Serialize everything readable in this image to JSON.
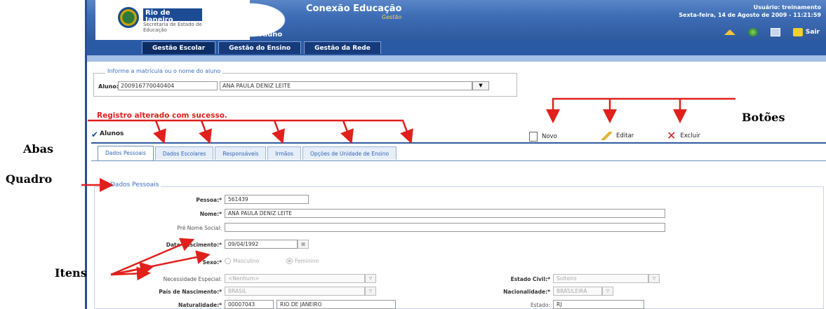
{
  "header": {
    "logo_text": "Rio de Janeiro",
    "logo_sub": "Secretaria de Estado de Educação",
    "app_title": "Conexão Educação",
    "app_subtitle": "Gestão",
    "page_name": "Aluno",
    "user_line": "Usuário: treinamento",
    "date_line": "Sexta-feira, 14 de Agosto de 2009 - 11:21:59",
    "exit_label": "Sair",
    "icons": [
      "home-icon",
      "globe-icon",
      "settings-icon",
      "exit-icon"
    ]
  },
  "nav": {
    "tabs": [
      "Gestão Escolar",
      "Gestão do Ensino",
      "Gestão da Rede"
    ]
  },
  "search": {
    "legend": "Informe a matrícula ou o nome do aluno",
    "label": "Aluno:*",
    "matricula": "200916770040404",
    "name": "ANA PAULA DENIZ LEITE"
  },
  "message": "Registro alterado com sucesso.",
  "section": {
    "title": "Alunos",
    "buttons": {
      "novo": "Novo",
      "editar": "Editar",
      "excluir": "Excluir"
    }
  },
  "tabs": [
    "Dados Pessoais",
    "Dados Escolares",
    "Responsáveis",
    "Irmãos",
    "Opções de Unidade de Ensino"
  ],
  "form": {
    "legend": "Dados Pessoais",
    "pessoa_label": "Pessoa:*",
    "pessoa": "561439",
    "nome_label": "Nome:*",
    "nome": "ANA PAULA DENIZ LEITE",
    "pre_nome_label": "Pré Nome Social:",
    "pre_nome": "",
    "nasc_label": "Data Nascimento:*",
    "nasc": "09/04/1992",
    "sexo_label": "Sexo:*",
    "sexo_options": [
      "Masculino",
      "Feminino"
    ],
    "nec_label": "Necessidade Especial:",
    "nec": "<Nenhum>",
    "estado_civil_label": "Estado Civil:*",
    "estado_civil": "Solteiro",
    "pais_label": "País de Nascimento:*",
    "pais": "BRASIL",
    "nacionalidade_label": "Nacionalidade:*",
    "nacionalidade": "BRASILEIRA",
    "naturalidade_label": "Naturalidade:*",
    "naturalidade_code": "00007043",
    "naturalidade_city": "RIO DE JANEIRO",
    "estado_label": "Estado:",
    "estado": "RJ"
  },
  "annotations": {
    "botoes": "Botões",
    "abas": "Abas",
    "quadro": "Quadro",
    "itens": "Itens"
  },
  "colors": {
    "header_blue": "#2f5aa0",
    "arrow_red": "#e0201c",
    "success_red": "#e0201c",
    "link_blue": "#3264b6"
  }
}
